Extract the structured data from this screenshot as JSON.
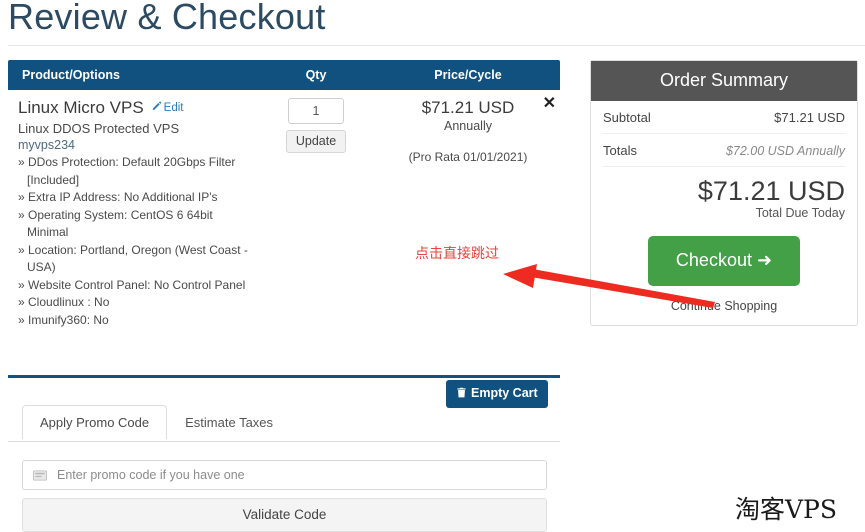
{
  "page": {
    "title": "Review & Checkout",
    "watermark": "淘客VPS"
  },
  "cart": {
    "headers": {
      "product": "Product/Options",
      "qty": "Qty",
      "price": "Price/Cycle"
    },
    "item": {
      "name": "Linux Micro VPS",
      "edit_label": "Edit",
      "description": "Linux DDOS Protected VPS",
      "domain": "myvps234",
      "options": [
        "» DDos Protection: Default 20Gbps Filter [Included]",
        "» Extra IP Address: No Additional IP's",
        "» Operating System: CentOS 6 64bit Minimal",
        "» Location: Portland, Oregon (West Coast - USA)",
        "» Website Control Panel: No Control Panel",
        "» Cloudlinux : No",
        "» Imunify360: No"
      ],
      "qty_value": "1",
      "update_label": "Update",
      "price": "$71.21 USD",
      "cycle": "Annually",
      "prorata": "(Pro Rata 01/01/2021)",
      "remove_label": "✕"
    },
    "empty_cart_label": "Empty Cart"
  },
  "tabs": [
    {
      "label": "Apply Promo Code",
      "active": true
    },
    {
      "label": "Estimate Taxes",
      "active": false
    }
  ],
  "promo": {
    "placeholder": "Enter promo code if you have one",
    "value": "",
    "validate_label": "Validate Code"
  },
  "summary": {
    "title": "Order Summary",
    "rows": [
      {
        "label": "Subtotal",
        "value": "$71.21 USD",
        "italic": false
      },
      {
        "label": "Totals",
        "value": "$72.00 USD Annually",
        "italic": true
      }
    ],
    "total_amount": "$71.21 USD",
    "total_label": "Total Due Today",
    "checkout_label": "Checkout ➜",
    "continue_label": "Continue Shopping"
  },
  "annotation": {
    "text": "点击直接跳过",
    "arrow_color": "#ee2b20"
  },
  "colors": {
    "header_blue": "#11517f",
    "title_blue": "#2c4b63",
    "summary_gray": "#555555",
    "checkout_green": "#43a047",
    "annotation_red": "#e8443a"
  }
}
